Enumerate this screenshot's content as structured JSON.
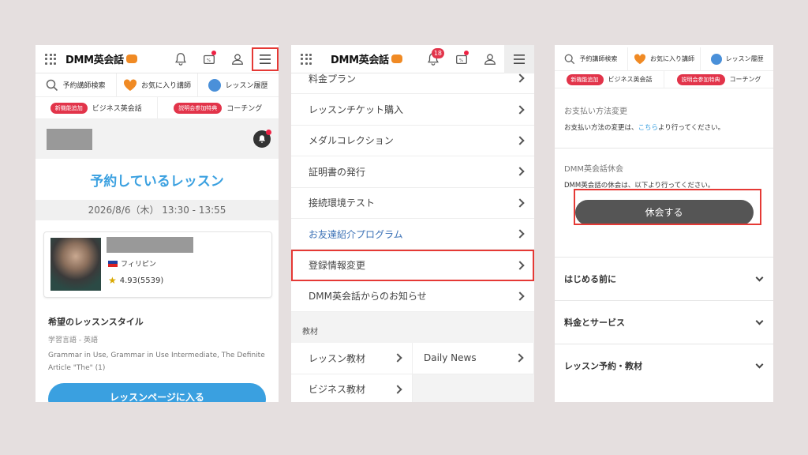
{
  "brand": {
    "logo_text": "DMM英会話"
  },
  "quicknav": {
    "search": "予約講師検索",
    "favorite": "お気に入り講師",
    "history": "レッスン履歴",
    "new_pill": "新機能追加",
    "business": "ビジネス英会話",
    "seminar_pill": "説明会参加特典",
    "coaching": "コーチング"
  },
  "panel1": {
    "title": "予約しているレッスン",
    "date": "2026/8/6（木） 13:30 - 13:55",
    "country": "フィリピン",
    "rating": "4.93(5539)",
    "style_heading": "希望のレッスンスタイル",
    "study_language": "学習言語 - 英語",
    "materials": "Grammar in Use, Grammar in Use Intermediate, The Definite Article \"The\" (1)",
    "enter_button": "レッスンページに入る"
  },
  "panel2": {
    "notification_count": "18",
    "items": [
      "料金プラン",
      "レッスンチケット購入",
      "メダルコレクション",
      "証明書の発行",
      "接続環境テスト",
      "お友達紹介プログラム",
      "登録情報変更",
      "DMM英会話からのお知らせ"
    ],
    "materials_section": "教材",
    "materials": [
      "レッスン教材",
      "Daily News",
      "ビジネス教材"
    ]
  },
  "panel3": {
    "payment_heading": "お支払い方法変更",
    "payment_text_pre": "お支払い方法の変更は、",
    "payment_link": "こちら",
    "payment_text_post": "より行ってください。",
    "pause_heading": "DMM英会話休会",
    "pause_text": "DMM英会話の休会は、以下より行ってください。",
    "pause_button": "休会する",
    "accordions": [
      "はじめる前に",
      "料金とサービス",
      "レッスン予約・教材"
    ]
  },
  "colors": {
    "accent_blue": "#3aa0e0",
    "highlight_red": "#e53935",
    "orange": "#f08a24"
  }
}
